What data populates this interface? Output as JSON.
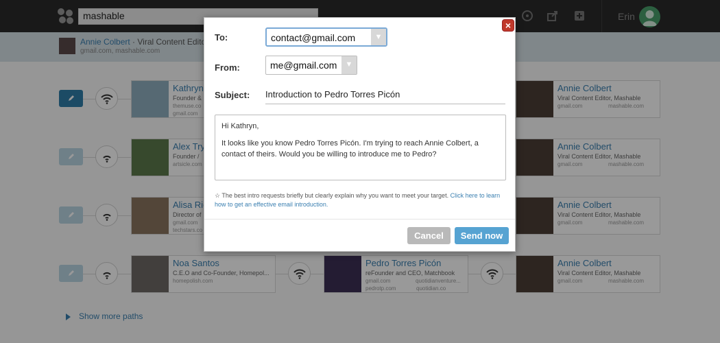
{
  "topbar": {
    "search_value": "mashable",
    "user_name": "Erin",
    "icons": [
      "logo-icon",
      "gauge-icon",
      "share-icon",
      "add-icon"
    ]
  },
  "subheader": {
    "name": "Annie Colbert",
    "title": " · Viral Content Editor",
    "emails": "gmail.com,  mashable.com"
  },
  "rows": [
    {
      "first": {
        "name": "Kathryn",
        "title": "Founder &",
        "line1": "themuse.co",
        "line2": "gmail.com"
      },
      "target": {
        "name": "Annie Colbert",
        "title": "Viral Content Editor, Mashable",
        "line1a": "gmail.com",
        "line1b": "mashable.com"
      }
    },
    {
      "first": {
        "name": "Alex Try",
        "title": "Founder /",
        "line1": "artsicle.com",
        "line2": ""
      },
      "target": {
        "name": "Annie Colbert",
        "title": "Viral Content Editor, Mashable",
        "line1a": "gmail.com",
        "line1b": "mashable.com"
      }
    },
    {
      "first": {
        "name": "Alisa Ric",
        "title": "Director of",
        "line1": "gmail.com",
        "line2": "techstars.co"
      },
      "target": {
        "name": "Annie Colbert",
        "title": "Viral Content Editor, Mashable",
        "line1a": "gmail.com",
        "line1b": "mashable.com"
      }
    },
    {
      "first": {
        "name": "Noa Santos",
        "title": "C.E.O and Co-Founder, Homepol...",
        "line1": "homepolish.com",
        "line2": ""
      },
      "middle": {
        "name": "Pedro Torres Picón",
        "title": "reFounder and CEO, Matchbook",
        "line1a": "gmail.com",
        "line1b": "quotidianventure...",
        "line2a": "pedrotp.com",
        "line2b": "quotidian.co"
      },
      "target": {
        "name": "Annie Colbert",
        "title": "Viral Content Editor, Mashable",
        "line1a": "gmail.com",
        "line1b": "mashable.com"
      }
    }
  ],
  "show_more": "Show more paths",
  "modal": {
    "to_label": "To:",
    "to_value": "contact@gmail.com",
    "from_label": "From:",
    "from_value": "me@gmail.com",
    "subject_label": "Subject:",
    "subject_value": "Introduction to Pedro Torres Picón",
    "message_greeting": "Hi Kathryn,",
    "message_body": "It looks like you know Pedro Torres Picón. I'm trying to reach Annie Colbert, a contact of theirs. Would you be willing to introduce me to Pedro?",
    "tip_text": "☆ The best intro requests briefly but clearly explain why you want to meet your target. ",
    "tip_link": "Click here to learn how to get an effective email introduction.",
    "cancel_label": "Cancel",
    "send_label": "Send now",
    "close_label": "×"
  },
  "colors": {
    "accent": "#3a7fb0",
    "send_button": "#56a3d2",
    "close_button": "#c0392b",
    "topbar": "#2b2b2b"
  }
}
